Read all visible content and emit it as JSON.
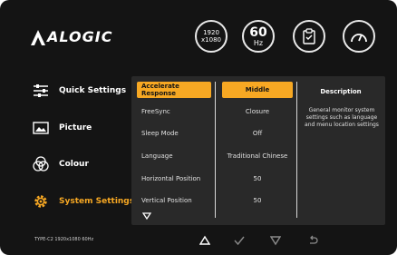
{
  "brand": {
    "logo": "ALOGIC"
  },
  "status": {
    "resolution_line1": "1920",
    "resolution_line2": "x1080",
    "refresh_value": "60",
    "refresh_unit": "Hz",
    "icons": [
      "resolution-badge",
      "refresh-rate-badge",
      "clipboard-check-icon",
      "gauge-icon"
    ]
  },
  "sidebar": {
    "items": [
      {
        "label": "Quick Settings",
        "icon": "sliders-icon",
        "active": false
      },
      {
        "label": "Picture",
        "icon": "picture-icon",
        "active": false
      },
      {
        "label": "Colour",
        "icon": "colour-icon",
        "active": false
      },
      {
        "label": "System Settings",
        "icon": "gear-icon",
        "active": true
      }
    ]
  },
  "menu": {
    "options": [
      {
        "label": "Accelerate Response",
        "value": "Middle",
        "selected": true
      },
      {
        "label": "FreeSync",
        "value": "Closure",
        "selected": false
      },
      {
        "label": "Sleep Mode",
        "value": "Off",
        "selected": false
      },
      {
        "label": "Language",
        "value": "Traditional Chinese",
        "selected": false
      },
      {
        "label": "Horizontal Position",
        "value": "50",
        "selected": false
      },
      {
        "label": "Vertical Position",
        "value": "50",
        "selected": false
      }
    ],
    "description_title": "Description",
    "description_body": "General monitor system settings such as language and menu location settings"
  },
  "footer": {
    "model_text": "TYPE-C2   1920x1080 60Hz",
    "nav_icons": [
      "triangle-up-icon",
      "check-icon",
      "triangle-down-icon",
      "return-icon"
    ]
  },
  "colors": {
    "accent": "#f7a823",
    "background": "#141414",
    "panel": "#292929"
  }
}
